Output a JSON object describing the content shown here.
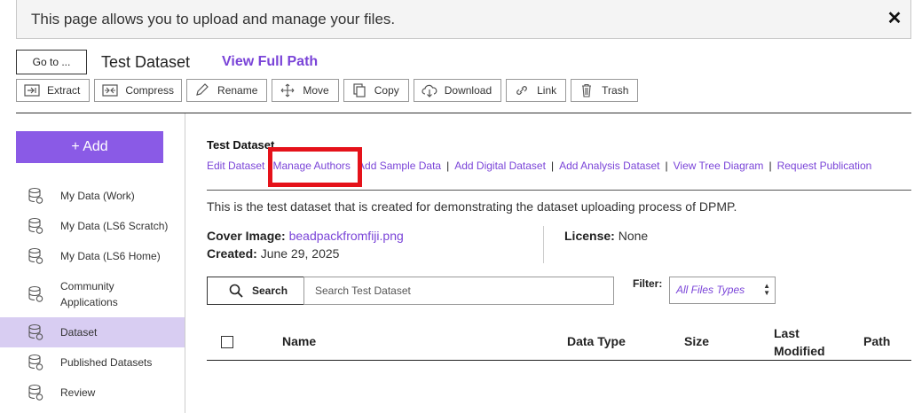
{
  "notice": {
    "text": "This page allows you to upload and manage your files.",
    "close_label": "✕"
  },
  "header": {
    "goto_label": "Go to ...",
    "dataset_name": "Test Dataset",
    "view_full_path": "View Full Path"
  },
  "toolbar": {
    "extract": "Extract",
    "compress": "Compress",
    "rename": "Rename",
    "move": "Move",
    "copy": "Copy",
    "download": "Download",
    "link": "Link",
    "trash": "Trash"
  },
  "sidebar": {
    "add_label": "+ Add",
    "items": [
      {
        "label": "My Data (Work)"
      },
      {
        "label": "My Data (LS6 Scratch)"
      },
      {
        "label": "My Data (LS6 Home)"
      },
      {
        "label": "Community Applications"
      },
      {
        "label": "Dataset",
        "active": true
      },
      {
        "label": "Published Datasets"
      },
      {
        "label": "Review"
      }
    ]
  },
  "main": {
    "title": "Test Dataset",
    "actions": {
      "edit_dataset": "Edit Dataset",
      "manage_authors": "Manage Authors",
      "add_sample_data": "Add Sample Data",
      "add_digital_dataset": "Add Digital Dataset",
      "add_analysis_dataset": "Add Analysis Dataset",
      "view_tree_diagram": "View Tree Diagram",
      "request_publication": "Request Publication",
      "separator": "|"
    },
    "description": "This is the test dataset that is created for demonstrating the dataset uploading process of DPMP.",
    "cover_label": "Cover Image:",
    "cover_file": "beadpackfromfiji.png",
    "created_label": "Created:",
    "created_value": "June 29, 2025",
    "license_label": "License:",
    "license_value": "None"
  },
  "search": {
    "button_label": "Search",
    "placeholder": "Search Test Dataset",
    "filter_label": "Filter:",
    "filter_value": "All Files Types"
  },
  "table": {
    "columns": {
      "name": "Name",
      "data_type": "Data Type",
      "size": "Size",
      "last_modified": "Last\nModified",
      "path": "Path"
    }
  },
  "colors": {
    "accent": "#7a44d8",
    "add_button": "#8a5ae6",
    "active_nav": "#d8cdf2",
    "highlight": "#e5121a"
  }
}
